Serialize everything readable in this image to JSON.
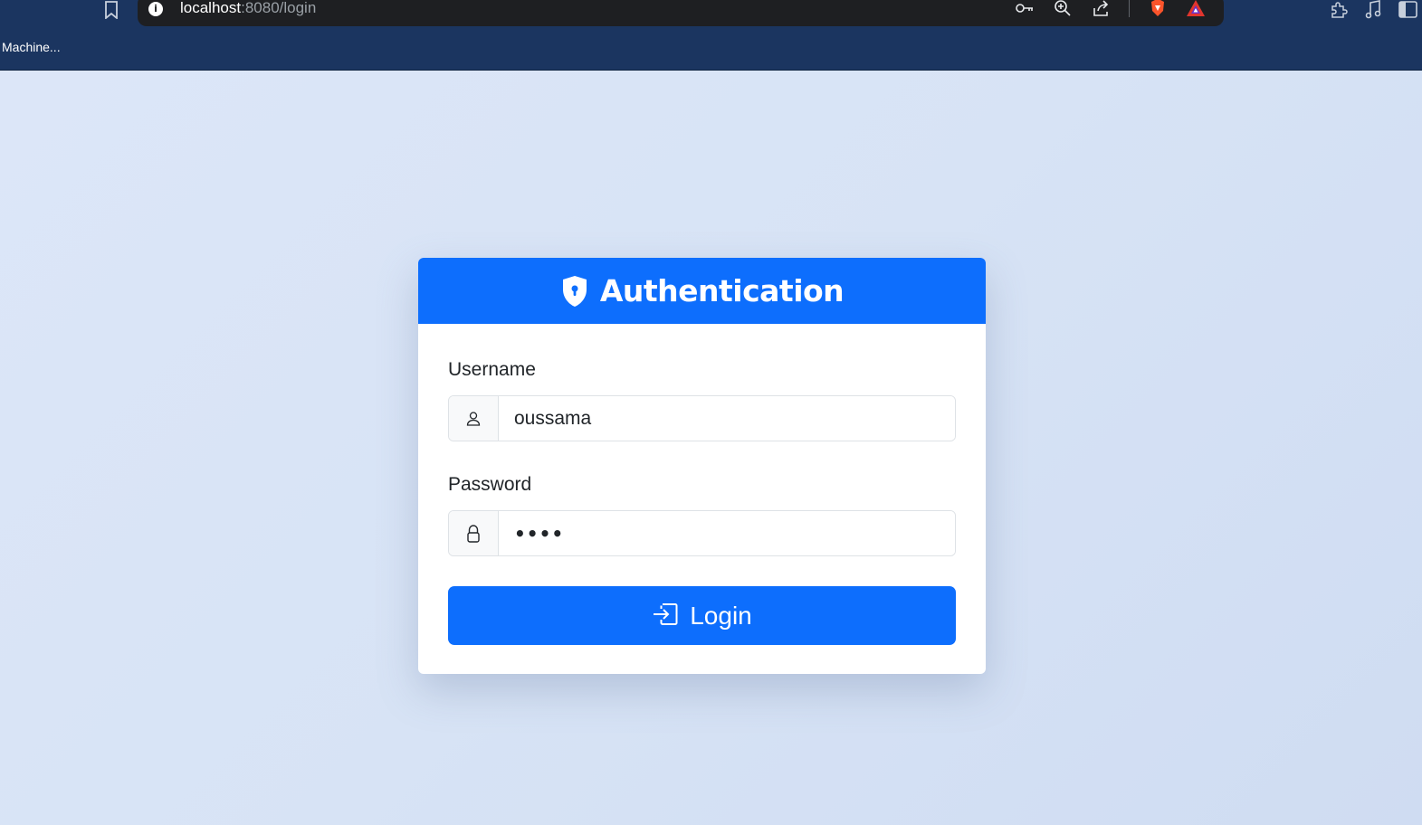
{
  "browser": {
    "url_host": "localhost",
    "url_rest": ":8080/login",
    "bookmarks": [
      "Machine..."
    ]
  },
  "card": {
    "title": "Authentication",
    "username": {
      "label": "Username",
      "value": "oussama"
    },
    "password": {
      "label": "Password",
      "value": "••••"
    },
    "login_label": "Login"
  },
  "colors": {
    "primary": "#0d6efd",
    "chrome": "#1b3560",
    "page_bg": "#d8e4f6"
  },
  "icons": {
    "header": "shield-lock-icon",
    "username": "person-icon",
    "password": "lock-icon",
    "login": "box-arrow-in-right-icon"
  }
}
